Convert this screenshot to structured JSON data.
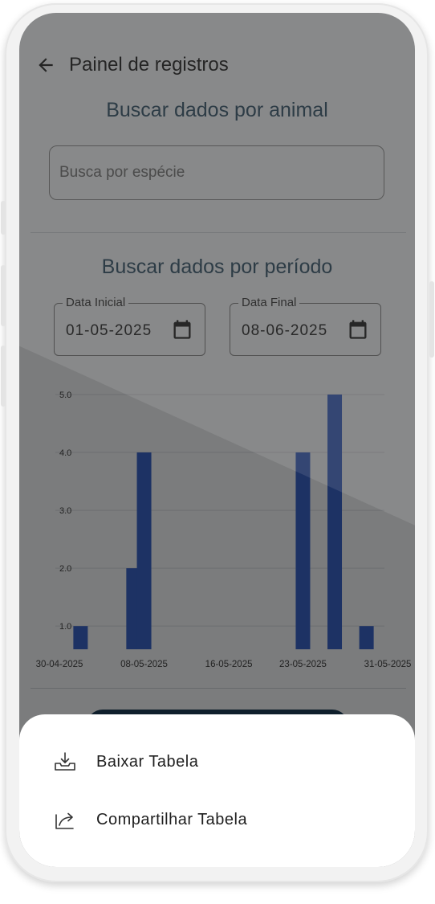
{
  "header": {
    "title": "Painel de registros"
  },
  "animal_search": {
    "title": "Buscar dados por animal",
    "placeholder": "Busca por espécie"
  },
  "period_search": {
    "title": "Buscar dados por período",
    "start": {
      "label": "Data Inicial",
      "value": "01-05-2025"
    },
    "end": {
      "label": "Data Final",
      "value": "08-06-2025"
    }
  },
  "chart_data": {
    "type": "bar",
    "categories": [
      "02-05-2025",
      "07-05-2025",
      "08-05-2025",
      "23-05-2025",
      "26-05-2025",
      "29-05-2025"
    ],
    "values": [
      1,
      2,
      4,
      4,
      5,
      1
    ],
    "x_ticks": [
      "30-04-2025",
      "08-05-2025",
      "16-05-2025",
      "23-05-2025",
      "31-05-2025"
    ],
    "y_ticks": [
      "1.0",
      "2.0",
      "3.0",
      "4.0",
      "5.0"
    ],
    "ylim": [
      0.6,
      5.0
    ],
    "grid": true,
    "bar_color": "#3a64c8",
    "title": "",
    "xlabel": "",
    "ylabel": ""
  },
  "bottom_sheet": {
    "items": [
      {
        "label": "Baixar Tabela",
        "icon": "download-tray-icon"
      },
      {
        "label": "Compartilhar Tabela",
        "icon": "share-icon"
      }
    ]
  },
  "colors": {
    "title": "#2d4d63",
    "primary": "#1e3e58",
    "bar": "#3a64c8",
    "scrim": "rgba(0,0,0,0.5)"
  }
}
